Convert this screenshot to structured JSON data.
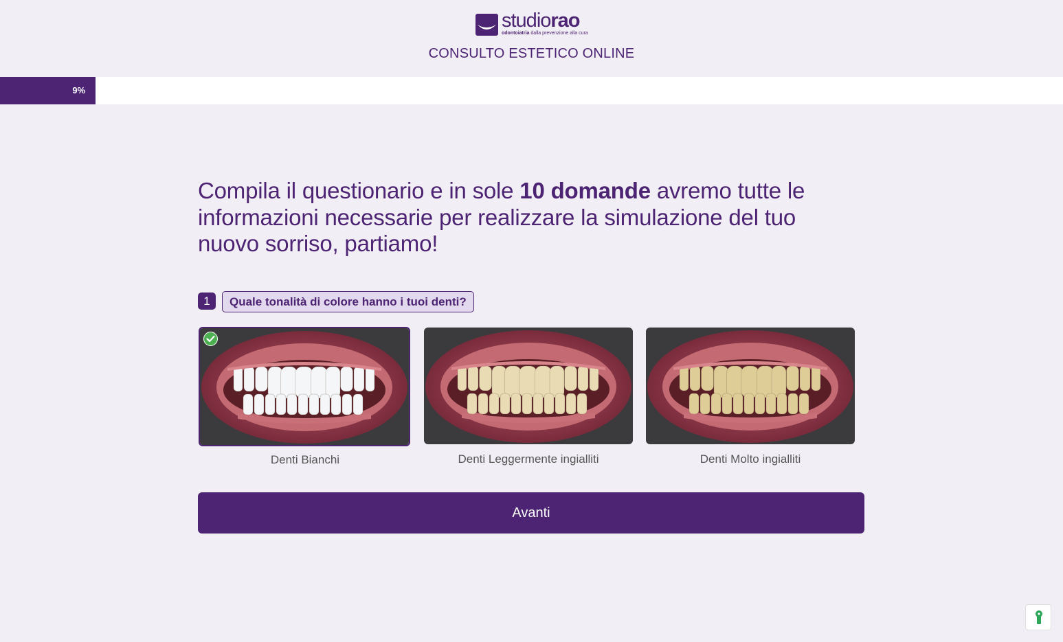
{
  "brand": {
    "name_light": "studio",
    "name_bold": "rao",
    "tagline_bold": "odontoiatria",
    "tagline_rest": "dalla prevenzione alla cura",
    "color": "#4d2374"
  },
  "header": {
    "title": "CONSULTO ESTETICO ONLINE"
  },
  "progress": {
    "value_percent": 9,
    "label": "9%"
  },
  "intro": {
    "text_before": "Compila il questionario e in sole ",
    "text_bold": "10 domande",
    "text_after": " avremo tutte le informazioni necessarie per realizzare la simulazione del tuo nuovo sorriso, partiamo!"
  },
  "question": {
    "number": "1",
    "text": "Quale tonalità di colore hanno i tuoi denti?",
    "selected_index": 0,
    "options": [
      {
        "label": "Denti Bianchi",
        "tooth_color": "#f4f6f8",
        "selected": true
      },
      {
        "label": "Denti Leggermente ingialliti",
        "tooth_color": "#e9dcb4",
        "selected": false
      },
      {
        "label": "Denti Molto ingialliti",
        "tooth_color": "#dfcd98",
        "selected": false
      }
    ]
  },
  "actions": {
    "next_label": "Avanti"
  },
  "icons": {
    "check": "check-circle-icon",
    "cookie": "cookie-preferences-icon"
  }
}
